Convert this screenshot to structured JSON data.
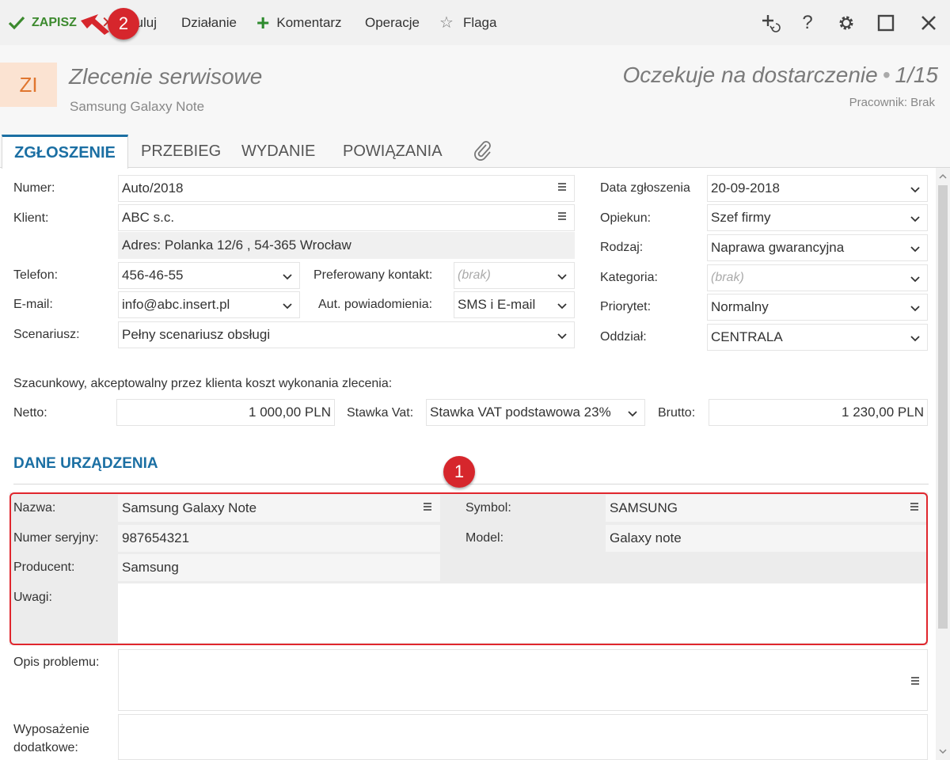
{
  "toolbar": {
    "save": "ZAPISZ",
    "cancel": "Anuluj",
    "action": "Działanie",
    "comment": "Komentarz",
    "operations": "Operacje",
    "flag": "Flaga"
  },
  "header": {
    "badge": "ZI",
    "title": "Zlecenie serwisowe",
    "subtitle": "Samsung Galaxy Note",
    "status": "Oczekuje na dostarczenie",
    "counter": "1/15",
    "worker": "Pracownik: Brak"
  },
  "tabs": [
    "ZGŁOSZENIE",
    "PRZEBIEG",
    "WYDANIE",
    "POWIĄZANIA"
  ],
  "form": {
    "numer_label": "Numer:",
    "numer": "Auto/2018",
    "klient_label": "Klient:",
    "klient": "ABC s.c.",
    "adres": "Adres:  Polanka  12/6 , 54-365 Wrocław",
    "telefon_label": "Telefon:",
    "telefon": "456-46-55",
    "pref_label": "Preferowany kontakt:",
    "pref": "(brak)",
    "email_label": "E-mail:",
    "email": "info@abc.insert.pl",
    "aut_label": "Aut. powiadomienia:",
    "aut": "SMS i E-mail",
    "scen_label": "Scenariusz:",
    "scen": "Pełny scenariusz obsługi",
    "data_label": "Data zgłoszenia",
    "data": "20-09-2018",
    "opiekun_label": "Opiekun:",
    "opiekun": "Szef firmy",
    "rodzaj_label": "Rodzaj:",
    "rodzaj": "Naprawa gwarancyjna",
    "kategoria_label": "Kategoria:",
    "kategoria": "(brak)",
    "priorytet_label": "Priorytet:",
    "priorytet": "Normalny",
    "oddzial_label": "Oddział:",
    "oddzial": "CENTRALA",
    "cost_text": "Szacunkowy, akceptowalny przez klienta koszt wykonania zlecenia:",
    "netto_label": "Netto:",
    "netto": "1 000,00 PLN",
    "vat_label": "Stawka Vat:",
    "vat": "Stawka VAT podstawowa 23%",
    "brutto_label": "Brutto:",
    "brutto": "1 230,00 PLN"
  },
  "device": {
    "section": "DANE URZĄDZENIA",
    "nazwa_label": "Nazwa:",
    "nazwa": "Samsung Galaxy Note",
    "symbol_label": "Symbol:",
    "symbol": "SAMSUNG",
    "sn_label": "Numer seryjny:",
    "sn": "987654321",
    "model_label": "Model:",
    "model": "Galaxy note",
    "prod_label": "Producent:",
    "prod": "Samsung",
    "uwagi_label": "Uwagi:",
    "opis_label": "Opis problemu:",
    "wypos_label_1": "Wyposażenie",
    "wypos_label_2": "dodatkowe:"
  },
  "markers": {
    "m1": "1",
    "m2": "2"
  },
  "colors": {
    "accent": "#1b6fa3",
    "save_green": "#3c8a2e",
    "marker_red": "#d6262c"
  }
}
